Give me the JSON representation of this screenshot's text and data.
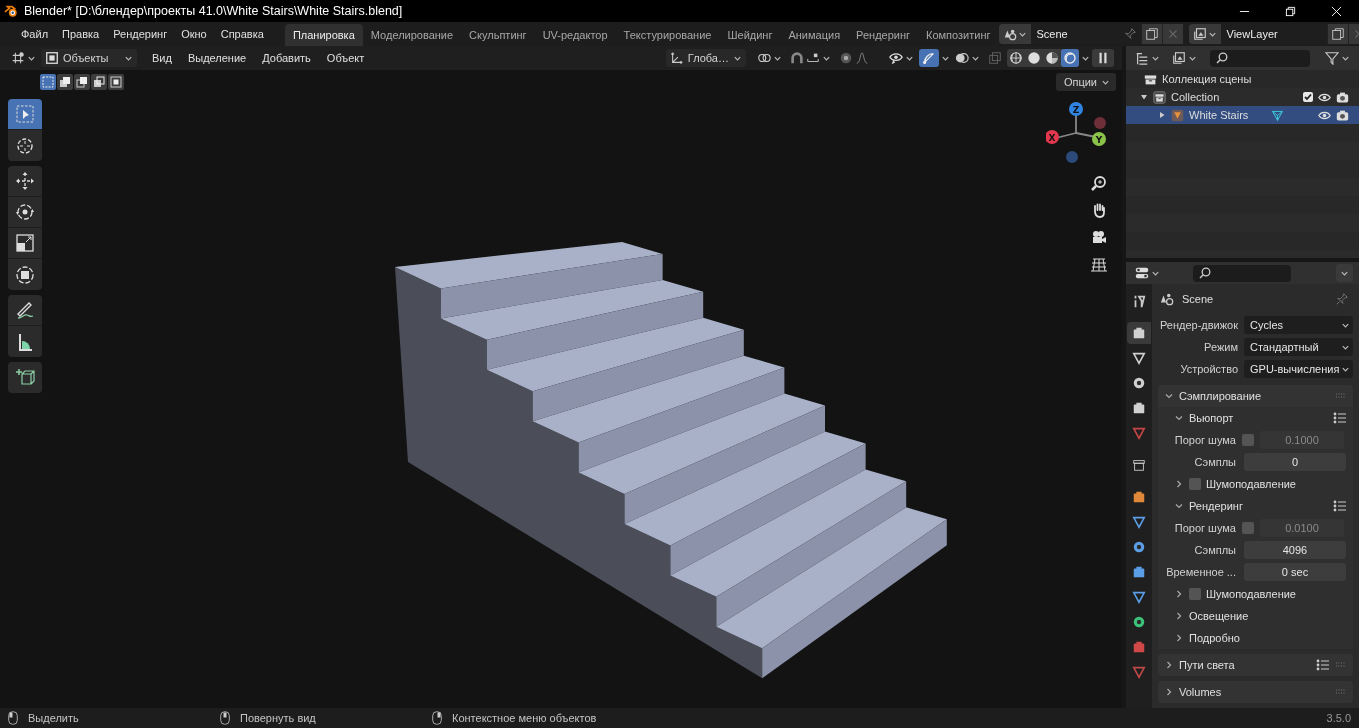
{
  "window": {
    "title": "Blender* [D:\\блендер\\проекты 41.0\\White Stairs\\White Stairs.blend]"
  },
  "menu": [
    "Файл",
    "Правка",
    "Рендеринг",
    "Окно",
    "Справка"
  ],
  "workspaces": [
    {
      "label": "Планировка",
      "selected": true
    },
    {
      "label": "Моделирование",
      "selected": false
    },
    {
      "label": "Скульптинг",
      "selected": false
    },
    {
      "label": "UV-редактор",
      "selected": false
    },
    {
      "label": "Текстурирование",
      "selected": false
    },
    {
      "label": "Шейдинг",
      "selected": false
    },
    {
      "label": "Анимация",
      "selected": false
    },
    {
      "label": "Рендеринг",
      "selected": false
    },
    {
      "label": "Композитинг",
      "selected": false
    }
  ],
  "scene": {
    "name": "Scene"
  },
  "view_layer": {
    "name": "ViewLayer"
  },
  "viewport": {
    "mode": "Объекты",
    "menus": [
      "Вид",
      "Выделение",
      "Добавить",
      "Объект"
    ],
    "orientation": "Глоба…",
    "gizmos": true,
    "shading": [
      {
        "selected": false
      },
      {
        "selected": false
      },
      {
        "selected": false
      },
      {
        "selected": true
      }
    ],
    "select_modes": [
      {
        "selected": true
      },
      {
        "selected": false
      },
      {
        "selected": false
      },
      {
        "selected": false
      },
      {
        "selected": false
      }
    ],
    "options": "Опции",
    "tools": [
      {
        "selected": true
      },
      {
        "selected": false
      },
      {
        "selected": false
      },
      {
        "selected": false
      },
      {
        "selected": false
      },
      {
        "selected": false
      },
      {
        "selected": false
      },
      {
        "selected": false
      },
      {
        "selected": false
      }
    ],
    "axes": [
      "X",
      "Y",
      "Z"
    ]
  },
  "outliner": {
    "root": "Коллекция сцены",
    "items": [
      {
        "kind": "collection",
        "label": "Collection",
        "expanded": true,
        "checked": true,
        "selected": false,
        "children": [
          {
            "kind": "object",
            "label": "White Stairs",
            "expanded": false,
            "selected": true
          }
        ]
      }
    ]
  },
  "properties": {
    "tabs": [
      {
        "selected": false
      },
      {
        "selected": true
      },
      {
        "selected": false
      },
      {
        "selected": false
      },
      {
        "selected": false
      },
      {
        "selected": false
      },
      {
        "selected": false
      },
      {
        "selected": false
      },
      {
        "selected": false
      },
      {
        "selected": false
      },
      {
        "selected": false
      },
      {
        "selected": false
      },
      {
        "selected": false
      },
      {
        "selected": false
      },
      {
        "selected": false
      }
    ],
    "context": "Scene",
    "fields": [
      {
        "label": "Рендер-движок",
        "value": "Cycles"
      },
      {
        "label": "Режим",
        "value": "Стандартный"
      },
      {
        "label": "Устройство",
        "value": "GPU-вычисления"
      }
    ],
    "panels": [
      {
        "title": "Сэмплирование",
        "expanded": true,
        "children": [
          {
            "title": "Вьюпорт",
            "expanded": true,
            "presets": true,
            "rows": [
              {
                "kind": "toggle-number",
                "label": "Порог шума",
                "checked": false,
                "value": "0.1000"
              },
              {
                "kind": "number",
                "label": "Сэмплы",
                "value": "0"
              }
            ],
            "children": [
              {
                "title": "Шумоподавление",
                "expanded": false,
                "checked": false
              }
            ]
          },
          {
            "title": "Рендеринг",
            "expanded": true,
            "presets": true,
            "rows": [
              {
                "kind": "toggle-number",
                "label": "Порог шума",
                "checked": false,
                "value": "0.0100"
              },
              {
                "kind": "number",
                "label": "Сэмплы",
                "value": "4096"
              },
              {
                "kind": "number",
                "label": "Временное ...",
                "value": "0 sec"
              }
            ],
            "children": [
              {
                "title": "Шумоподавление",
                "expanded": false,
                "checked": false
              }
            ]
          },
          {
            "title": "Освещение",
            "expanded": false
          },
          {
            "title": "Подробно",
            "expanded": false
          }
        ]
      },
      {
        "title": "Пути света",
        "expanded": false,
        "presets": true
      },
      {
        "title": "Volumes",
        "expanded": false
      }
    ]
  },
  "status": [
    {
      "label": "Выделить"
    },
    {
      "label": "Повернуть вид"
    },
    {
      "label": "Контекстное меню объектов"
    }
  ],
  "version": "3.5.0"
}
